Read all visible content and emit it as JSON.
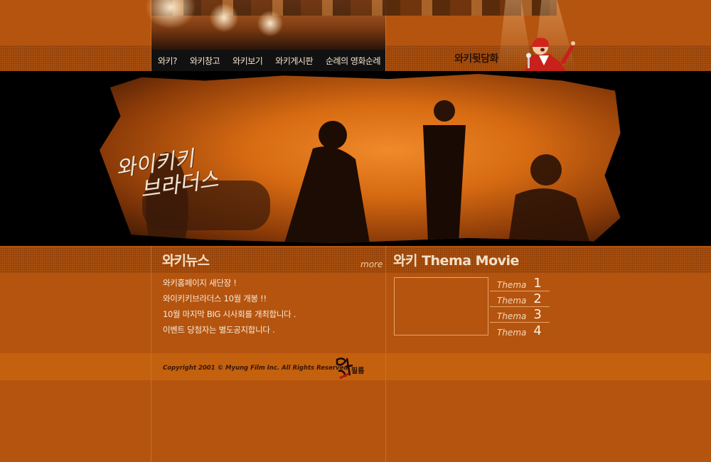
{
  "nav": {
    "items": [
      "와키?",
      "와키창고",
      "와키보기",
      "와키게시판",
      "순례의 영화순례"
    ]
  },
  "mascot": {
    "label": "와키뒷담화"
  },
  "hero": {
    "title_line1": "와이키키",
    "title_line2": "브라더스"
  },
  "news": {
    "title": "와키뉴스",
    "more": "more",
    "items": [
      "와키홈페이지 새단장 !",
      "와이키키브라더스 10월 개봉 !!",
      "10월 마지막 BIG 시사회를 개최합니다 .",
      "이벤트 당첨자는 별도공지합니다 ."
    ]
  },
  "thema": {
    "title": "와키 Thema Movie",
    "items": [
      {
        "word": "Thema",
        "num": "1"
      },
      {
        "word": "Thema",
        "num": "2"
      },
      {
        "word": "Thema",
        "num": "3"
      },
      {
        "word": "Thema",
        "num": "4"
      }
    ]
  },
  "footer": {
    "copyright": "Copyright 2001 ©  Myung Film Inc. All Rights Reserved.",
    "logo_text": "필름"
  },
  "colors": {
    "background": "#b5540f",
    "accent": "#e8a36a",
    "dark": "#111111"
  }
}
